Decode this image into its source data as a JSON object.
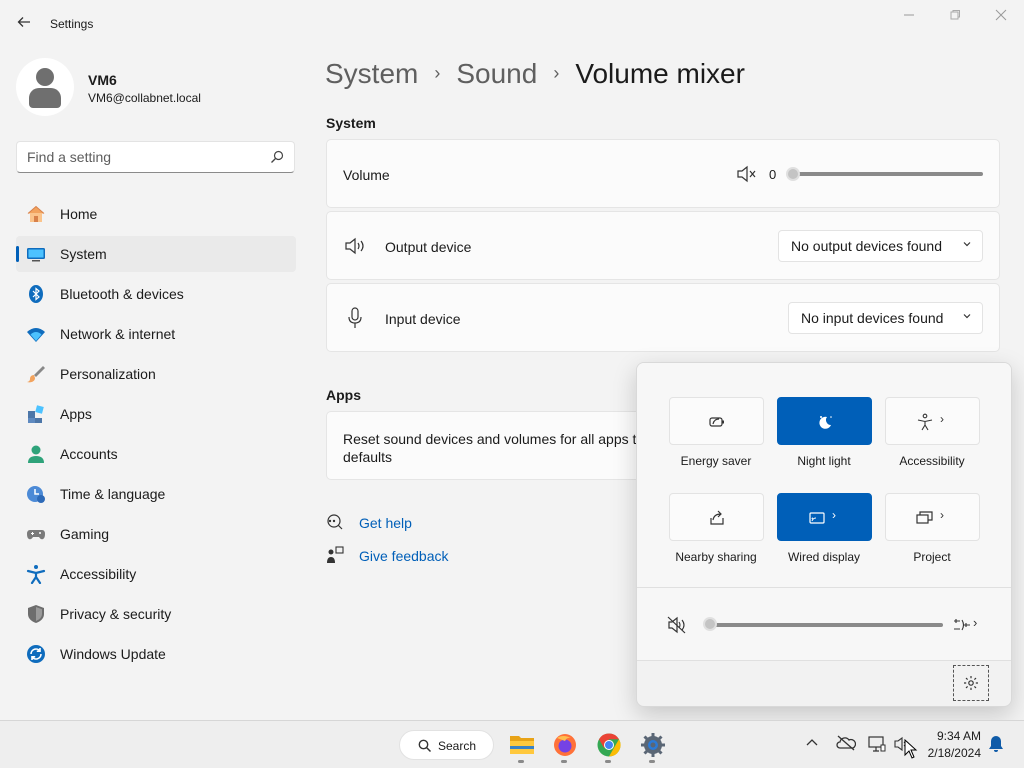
{
  "window": {
    "title": "Settings",
    "back_icon": "arrow-left-icon",
    "controls": [
      "minimize-icon",
      "maximize-icon",
      "close-icon"
    ]
  },
  "profile": {
    "name": "VM6",
    "email": "VM6@collabnet.local"
  },
  "search": {
    "placeholder": "Find a setting",
    "value": ""
  },
  "sidebar": {
    "items": [
      {
        "label": "Home",
        "icon": "home-icon",
        "active": false
      },
      {
        "label": "System",
        "icon": "system-icon",
        "active": true
      },
      {
        "label": "Bluetooth & devices",
        "icon": "bluetooth-icon",
        "active": false
      },
      {
        "label": "Network & internet",
        "icon": "wifi-icon",
        "active": false
      },
      {
        "label": "Personalization",
        "icon": "brush-icon",
        "active": false
      },
      {
        "label": "Apps",
        "icon": "apps-icon",
        "active": false
      },
      {
        "label": "Accounts",
        "icon": "accounts-icon",
        "active": false
      },
      {
        "label": "Time & language",
        "icon": "clock-globe-icon",
        "active": false
      },
      {
        "label": "Gaming",
        "icon": "gamepad-icon",
        "active": false
      },
      {
        "label": "Accessibility",
        "icon": "accessibility-icon",
        "active": false
      },
      {
        "label": "Privacy & security",
        "icon": "shield-icon",
        "active": false
      },
      {
        "label": "Windows Update",
        "icon": "update-icon",
        "active": false
      }
    ]
  },
  "breadcrumb": {
    "items": [
      "System",
      "Sound"
    ],
    "current": "Volume mixer"
  },
  "system_section": {
    "title": "System",
    "volume": {
      "label": "Volume",
      "value": "0",
      "level": 0
    },
    "output": {
      "label": "Output device",
      "selected": "No output devices found"
    },
    "input": {
      "label": "Input device",
      "selected": "No input devices found"
    }
  },
  "apps_section": {
    "title": "Apps",
    "reset_line1": "Reset sound devices and volumes for all apps to",
    "reset_line2": "defaults"
  },
  "links": {
    "help": "Get help",
    "feedback": "Give feedback"
  },
  "quick_settings": {
    "tiles": [
      {
        "label": "Energy saver",
        "on": false,
        "icon": "energy-saver-icon",
        "chevron": false
      },
      {
        "label": "Night light",
        "on": true,
        "icon": "night-light-icon",
        "chevron": false
      },
      {
        "label": "Accessibility",
        "on": false,
        "icon": "accessibility-icon",
        "chevron": true
      },
      {
        "label": "Nearby sharing",
        "on": false,
        "icon": "share-icon",
        "chevron": false
      },
      {
        "label": "Wired display",
        "on": true,
        "icon": "cast-icon",
        "chevron": true
      },
      {
        "label": "Project",
        "on": false,
        "icon": "project-icon",
        "chevron": true
      }
    ],
    "volume_level": 0
  },
  "taskbar": {
    "search_label": "Search",
    "time": "9:34 AM",
    "date": "2/18/2024"
  },
  "colors": {
    "accent": "#005fb8",
    "link": "#005fb8",
    "background": "#f3f3f3"
  }
}
